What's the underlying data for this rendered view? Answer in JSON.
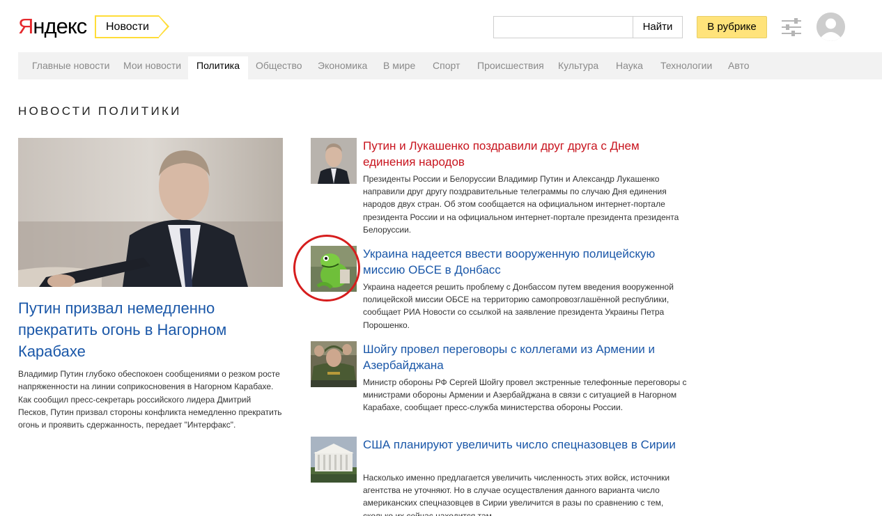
{
  "header": {
    "logo_first_letter": "Я",
    "logo_rest": "ндекс",
    "service_label": "Новости",
    "search_value": "",
    "search_button_label": "Найти",
    "rubric_button_label": "В рубрике"
  },
  "nav": {
    "items": [
      {
        "label": "Главные новости"
      },
      {
        "label": "Мои новости"
      },
      {
        "label": "Политика"
      },
      {
        "label": "Общество"
      },
      {
        "label": "Экономика"
      },
      {
        "label": "В мире"
      },
      {
        "label": "Спорт"
      },
      {
        "label": "Происшествия"
      },
      {
        "label": "Культура"
      },
      {
        "label": "Наука"
      },
      {
        "label": "Технологии"
      },
      {
        "label": "Авто"
      }
    ],
    "active_label": "Политика"
  },
  "section_title": "НОВОСТИ ПОЛИТИКИ",
  "lead": {
    "title": "Путин призвал немедленно прекратить огонь в Нагорном Карабахе",
    "text": "Владимир Путин глубоко обеспокоен сообщениями о резком росте напряженности на линии соприкосновения в Нагорном Карабахе. Как сообщил пресс-секретарь российского лидера Дмитрий Песков, Путин призвал стороны конфликта немедленно прекратить огонь и проявить сдержанность, передает \"Интерфакс\"."
  },
  "stories": [
    {
      "title": "Путин и Лукашенко поздравили друг друга с Днем единения народов",
      "text": "Президенты России и Белоруссии Владимир Путин и Александр Лукашенко направили друг другу поздравительные телеграммы по случаю Дня единения народов двух стран. Об этом сообщается на официальном интернет-портале президента России и на официальном интернет-портале президента президента Белоруссии."
    },
    {
      "title": "Украина надеется ввести вооруженную полицейскую миссию ОБСЕ в Донбасс",
      "text": "Украина надеется решить проблему с Донбассом путем введения вооруженной полицейской миссии ОБСЕ на территорию самопровозглашённой республики, сообщает РИА Новости со ссылкой на заявление президента Украины Петра Порошенко."
    },
    {
      "title": "Шойгу провел переговоры с коллегами из Армении и Азербайджана",
      "text": "Министр обороны РФ Сергей Шойгу провел экстренные телефонные переговоры с министрами обороны Армении и Азербайджана в связи с ситуацией в Нагорном Карабахе, сообщает пресс-служба министерства обороны России."
    },
    {
      "title": "США планируют увеличить число спецназовцев в Сирии",
      "text": "Насколько именно предлагается увеличить численность этих войск, источники агентства не уточняют. Но в случае осуществления данного варианта число американских спецназовцев в Сирии увеличится в разы по сравнению с тем, сколько их сейчас находится там."
    }
  ],
  "colors": {
    "link_blue": "#1a57a8",
    "headline_red": "#c8141e",
    "logo_red": "#e5292d",
    "accent_yellow": "#ffdd38",
    "rubric_button_bg": "#ffe37a",
    "annotation_circle": "#d61d1d"
  },
  "icons": {
    "settings": "sliders-icon",
    "avatar": "user-avatar-icon"
  }
}
